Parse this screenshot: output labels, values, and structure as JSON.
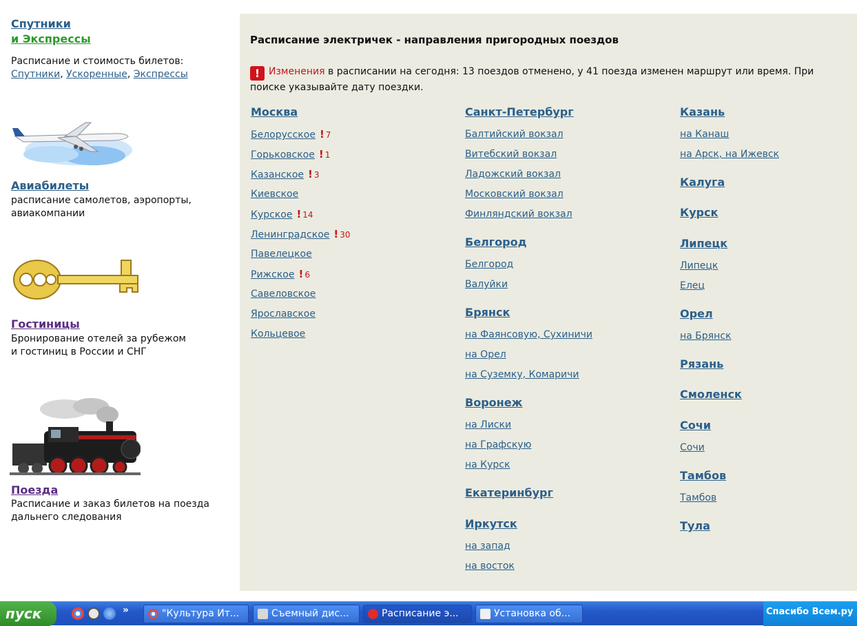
{
  "sidebar": {
    "express": {
      "title_line1": "Спутники",
      "title_line2": "и Экспрессы",
      "text": "Расписание и стоимость билетов:",
      "links": [
        "Спутники",
        "Ускоренные",
        "Экспрессы"
      ]
    },
    "avia": {
      "title": "Авиабилеты",
      "text1": "расписание самолетов, аэропорты,",
      "text2": "авиакомпании"
    },
    "hotels": {
      "title": "Гостиницы",
      "text1": "Бронирование отелей за рубежом",
      "text2": "и гостиниц в России и СНГ"
    },
    "trains": {
      "title": "Поезда",
      "text1": "Расписание и заказ билетов на поезда",
      "text2": "дальнего следования"
    }
  },
  "main": {
    "title": "Расписание электричек - направления пригородных поездов",
    "notice": {
      "link": "Изменения",
      "text": "в расписании на сегодня: 13 поездов отменено, у 41 поезда изменен маршрут или время. При поиске указывайте дату поездки."
    },
    "col1": {
      "moscow": {
        "name": "Москва",
        "stations": [
          {
            "name": "Белорусское",
            "changes": "7"
          },
          {
            "name": "Горьковское",
            "changes": "1"
          },
          {
            "name": "Казанское",
            "changes": "3"
          },
          {
            "name": "Киевское",
            "changes": ""
          },
          {
            "name": "Курское",
            "changes": "14"
          },
          {
            "name": "Ленинградское",
            "changes": "30"
          },
          {
            "name": "Павелецкое",
            "changes": ""
          },
          {
            "name": "Рижское",
            "changes": "6"
          },
          {
            "name": "Савеловское",
            "changes": ""
          },
          {
            "name": "Ярославское",
            "changes": ""
          },
          {
            "name": "Кольцевое",
            "changes": ""
          }
        ]
      }
    },
    "col2": {
      "spb": {
        "name": "Санкт-Петербург",
        "stations": [
          "Балтийский вокзал",
          "Витебский вокзал",
          "Ладожский вокзал",
          "Московский вокзал",
          "Финляндский вокзал"
        ]
      },
      "belgorod": {
        "name": "Белгород",
        "stations": [
          "Белгород",
          "Валуйки"
        ]
      },
      "bryansk": {
        "name": "Брянск",
        "stations": [
          "на Фаянсовую, Сухиничи",
          "на Орел",
          "на Суземку, Комаричи"
        ]
      },
      "voronezh": {
        "name": "Воронеж",
        "stations": [
          "на Лиски",
          "на Графскую",
          "на Курск"
        ]
      },
      "ekb": {
        "name": "Екатеринбург"
      },
      "irkutsk": {
        "name": "Иркутск",
        "stations": [
          "на запад",
          "на восток"
        ]
      }
    },
    "col3": {
      "kazan": {
        "name": "Казань",
        "stations": [
          "на Канаш",
          "на Арск, на Ижевск"
        ]
      },
      "kaluga": {
        "name": "Калуга"
      },
      "kursk": {
        "name": "Курск"
      },
      "lipetsk": {
        "name": "Липецк",
        "stations": [
          "Липецк",
          "Елец"
        ]
      },
      "orel": {
        "name": "Орел",
        "stations": [
          "на Брянск"
        ]
      },
      "ryazan": {
        "name": "Рязань"
      },
      "smolensk": {
        "name": "Смоленск"
      },
      "sochi": {
        "name": "Сочи",
        "stations": [
          "Сочи"
        ]
      },
      "tambov": {
        "name": "Тамбов",
        "stations": [
          "Тамбов"
        ]
      },
      "tula": {
        "name": "Тула"
      }
    },
    "warn_glyph": "!"
  },
  "taskbar": {
    "start": "пуск",
    "overflow": "»",
    "tasks": [
      "\"Культура Ит...",
      "Съемный дис...",
      "Расписание э...",
      "Установка об..."
    ],
    "tray": "Спасибо Всем.ру"
  },
  "colors": {
    "link": "#2b5f8a",
    "panel": "#ebebe1",
    "warn": "#c4161c",
    "express": "#2e9a2e",
    "visited": "#5a2d82"
  }
}
